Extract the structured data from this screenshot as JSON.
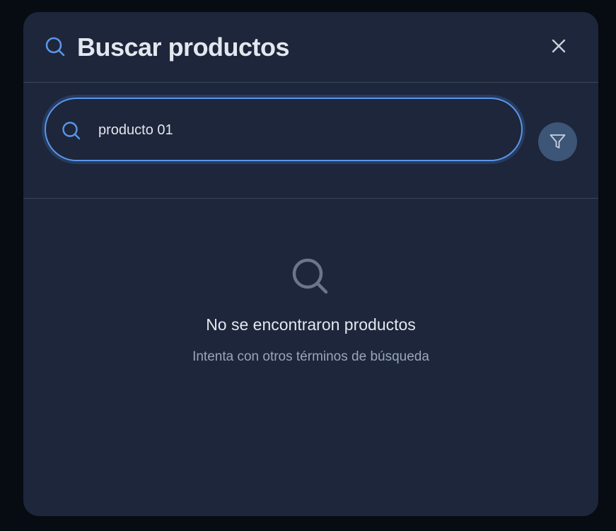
{
  "header": {
    "title": "Buscar productos",
    "icon": "search-icon",
    "close_icon": "close-icon"
  },
  "search": {
    "value": "producto 01",
    "placeholder": "",
    "icon": "search-icon",
    "filter_icon": "filter-icon"
  },
  "empty_state": {
    "icon": "search-icon",
    "title": "No se encontraron productos",
    "subtitle": "Intenta con otros términos de búsqueda"
  },
  "colors": {
    "background": "#070b12",
    "panel": "#1d263a",
    "accent": "#5b95e8",
    "filter_button": "#3d5577"
  }
}
